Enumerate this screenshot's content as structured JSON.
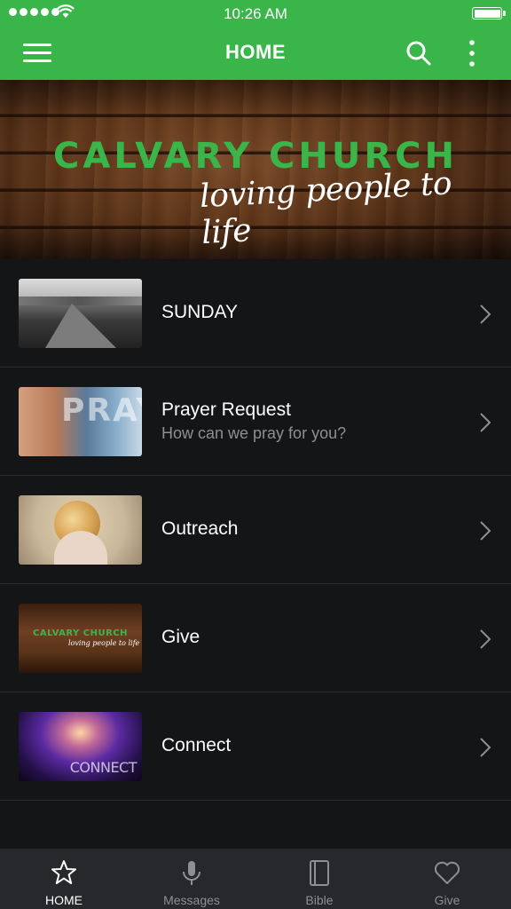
{
  "status_bar": {
    "time": "10:26 AM",
    "signal_bars": 5,
    "battery_level": 1.0
  },
  "nav": {
    "title": "HOME",
    "icons": [
      "menu-icon",
      "search-icon",
      "more-vertical-icon"
    ]
  },
  "banner": {
    "title": "CALVARY CHURCH",
    "tagline": "loving people to life"
  },
  "list": {
    "items": [
      {
        "title": "SUNDAY",
        "subtitle": "",
        "thumbnail": "road-image"
      },
      {
        "title": "Prayer Request",
        "subtitle": "How can we pray for you?",
        "thumbnail": "pray-image"
      },
      {
        "title": "Outreach",
        "subtitle": "",
        "thumbnail": "globe-image"
      },
      {
        "title": "Give",
        "subtitle": "",
        "thumbnail": "give-banner-image"
      },
      {
        "title": "Connect",
        "subtitle": "",
        "thumbnail": "connect-image"
      }
    ]
  },
  "thumbs": {
    "pray_word": "PRAY",
    "give_title": "CALVARY CHURCH",
    "give_tagline": "loving people to life",
    "connect_word": "CONNECT"
  },
  "tabs": [
    {
      "label": "HOME",
      "icon": "star-icon",
      "active": true
    },
    {
      "label": "Messages",
      "icon": "microphone-icon",
      "active": false
    },
    {
      "label": "Bible",
      "icon": "book-icon",
      "active": false
    },
    {
      "label": "Give",
      "icon": "heart-icon",
      "active": false
    }
  ],
  "colors": {
    "brand_green": "#3ab54a",
    "background": "#141517",
    "tab_bar": "#27282b",
    "subtitle_gray": "#8e8f93"
  }
}
